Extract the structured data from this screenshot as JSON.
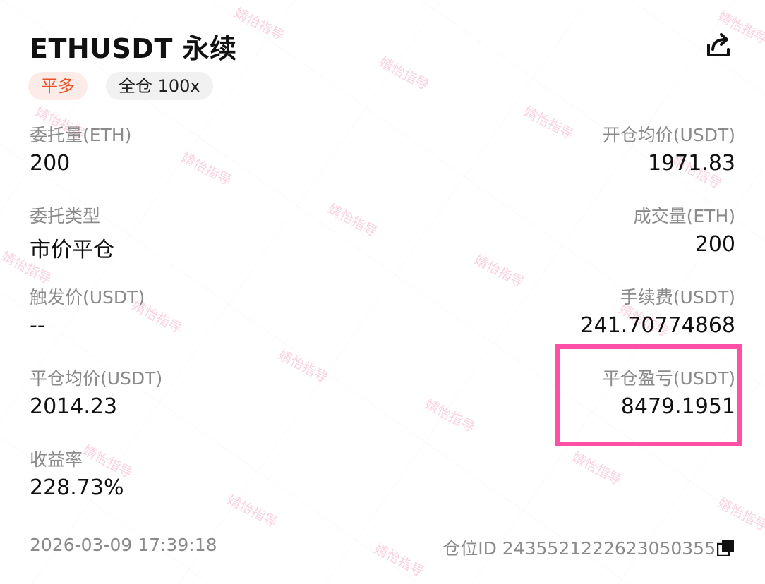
{
  "header": {
    "title": "ETHUSDT 永续",
    "side_tag": "平多",
    "margin_tag": "全仓 100x",
    "share_icon": "share-icon"
  },
  "fields": {
    "order_qty": {
      "label": "委托量(ETH)",
      "value": "200"
    },
    "open_avg_price": {
      "label": "开仓均价(USDT)",
      "value": "1971.83"
    },
    "order_type": {
      "label": "委托类型",
      "value": "市价平仓"
    },
    "filled_qty": {
      "label": "成交量(ETH)",
      "value": "200"
    },
    "trigger_price": {
      "label": "触发价(USDT)",
      "value": "--"
    },
    "fee": {
      "label": "手续费(USDT)",
      "value": "241.70774868"
    },
    "close_avg_price": {
      "label": "平仓均价(USDT)",
      "value": "2014.23"
    },
    "close_pnl": {
      "label": "平仓盈亏(USDT)",
      "value": "8479.1951"
    },
    "roi": {
      "label": "收益率",
      "value": "228.73%"
    }
  },
  "footer": {
    "timestamp": "2026-03-09 17:39:18",
    "position_id": "仓位ID 2435521222623050355",
    "copy_icon": "copy-icon"
  },
  "watermark": {
    "text": "婧怡指导"
  },
  "colors": {
    "side_tag_text": "#e8502a",
    "side_tag_bg": "#fcebe6",
    "highlight": "#ff4fa7",
    "label": "#8a8a8a"
  }
}
